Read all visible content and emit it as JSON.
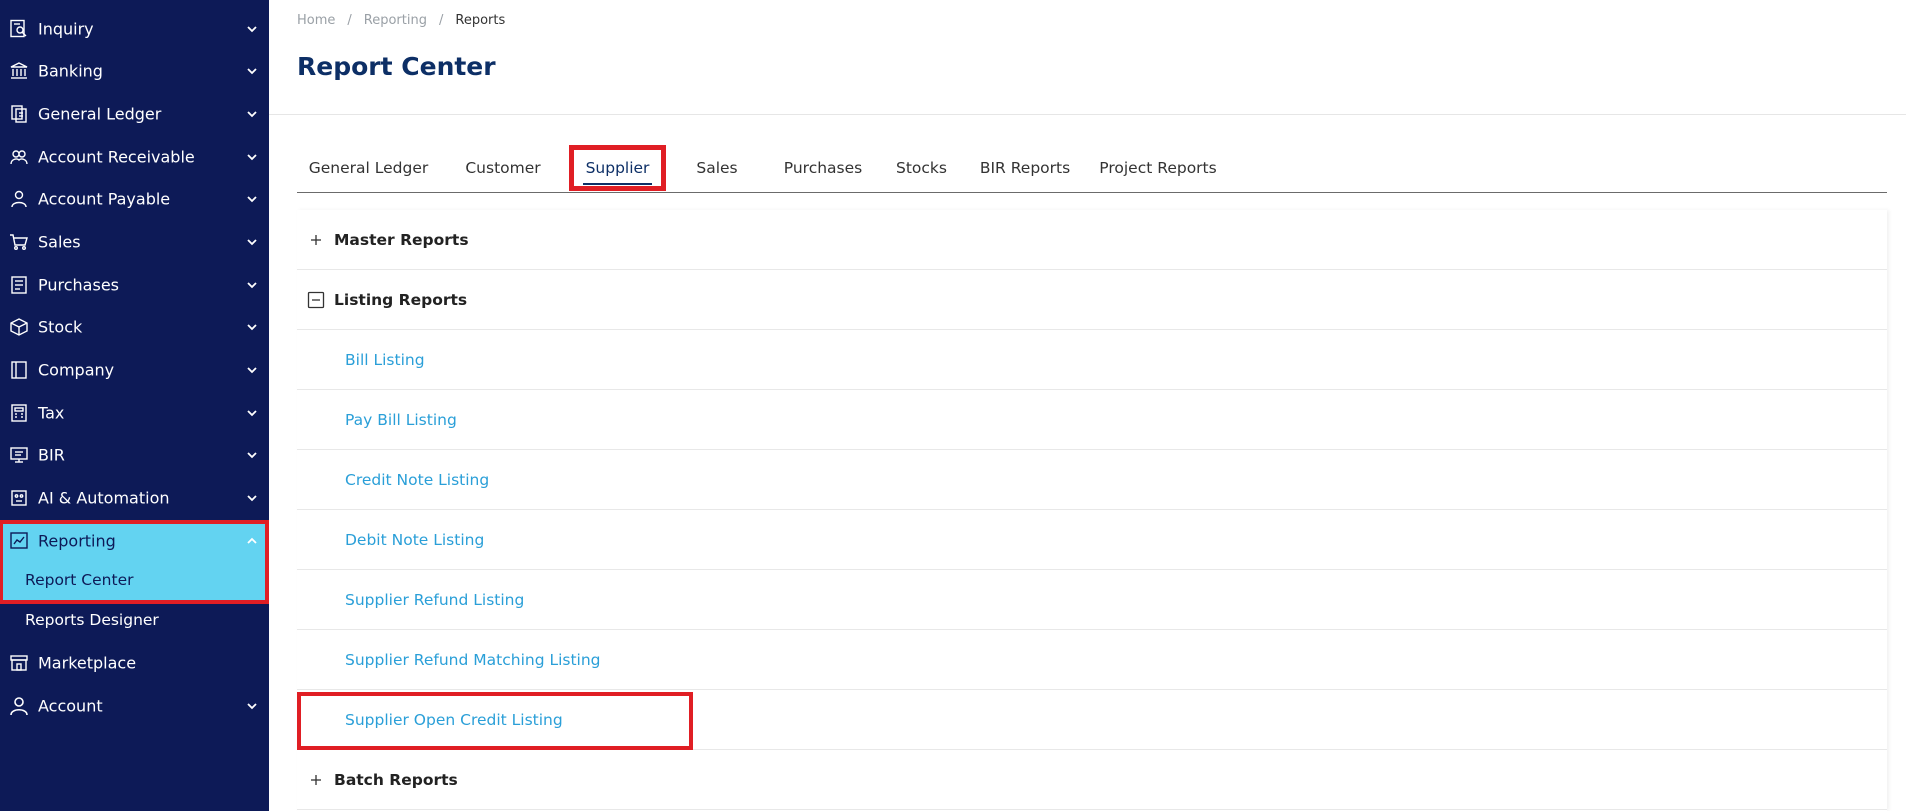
{
  "sidebar": {
    "items": [
      {
        "label": "Inquiry",
        "icon": "inquiry-icon"
      },
      {
        "label": "Banking",
        "icon": "bank-icon"
      },
      {
        "label": "General Ledger",
        "icon": "ledger-icon"
      },
      {
        "label": "Account Receivable",
        "icon": "receivable-icon"
      },
      {
        "label": "Account Payable",
        "icon": "payable-icon"
      },
      {
        "label": "Sales",
        "icon": "cart-icon"
      },
      {
        "label": "Purchases",
        "icon": "purchases-icon"
      },
      {
        "label": "Stock",
        "icon": "box-icon"
      },
      {
        "label": "Company",
        "icon": "company-icon"
      },
      {
        "label": "Tax",
        "icon": "tax-icon"
      },
      {
        "label": "BIR",
        "icon": "bir-icon"
      },
      {
        "label": "AI & Automation",
        "icon": "robot-icon"
      },
      {
        "label": "Reporting",
        "icon": "chart-icon"
      },
      {
        "label": "Marketplace",
        "icon": "store-icon"
      },
      {
        "label": "Account",
        "icon": "user-icon"
      }
    ],
    "reporting_sub": [
      "Report Center",
      "Reports Designer"
    ]
  },
  "breadcrumb": {
    "home": "Home",
    "section": "Reporting",
    "current": "Reports",
    "separator": "/"
  },
  "page_title": "Report Center",
  "tabs": [
    "General Ledger",
    "Customer",
    "Supplier",
    "Sales",
    "Purchases",
    "Stocks",
    "BIR Reports",
    "Project Reports"
  ],
  "active_tab": "Supplier",
  "sections": {
    "master": "Master Reports",
    "listing": "Listing Reports",
    "batch": "Batch Reports"
  },
  "listing_reports": [
    "Bill Listing",
    "Pay Bill Listing",
    "Credit Note Listing",
    "Debit Note Listing",
    "Supplier Refund Listing",
    "Supplier Refund Matching Listing",
    "Supplier Open Credit Listing"
  ],
  "colors": {
    "sidebar_bg": "#0d1a57",
    "active_bg": "#63d3f1",
    "highlight": "#e01e24",
    "title": "#0d2f66",
    "link": "#2a9fd8"
  }
}
